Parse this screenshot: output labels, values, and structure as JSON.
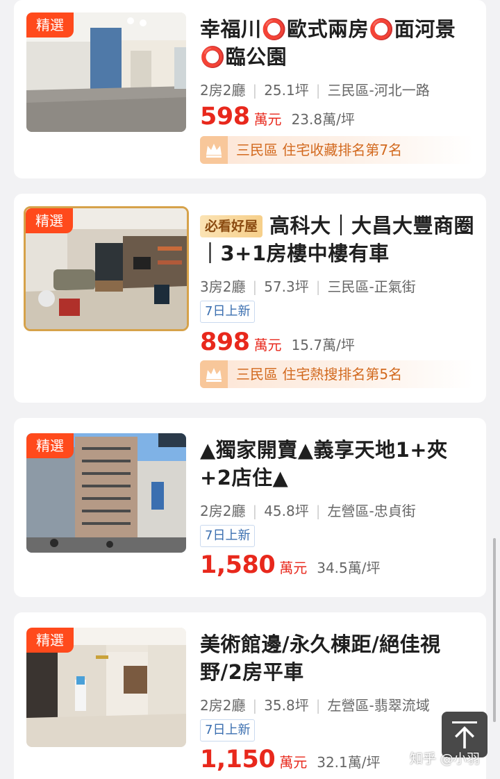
{
  "listings": [
    {
      "badge": "精選",
      "title": "幸福川⭕️歐式兩房⭕️面河景⭕️臨公園",
      "layout": "2房2廳",
      "size": "25.1坪",
      "location": "三民區-河北一路",
      "price": "598",
      "price_unit": "萬元",
      "price_per_ping": "23.8萬/坪",
      "rank_text": "三民區 住宅收藏排名第7名"
    },
    {
      "badge": "精選",
      "must_see": "必看好屋",
      "title": "高科大｜大昌大豐商圈｜3+1房樓中樓有車",
      "layout": "3房2廳",
      "size": "57.3坪",
      "location": "三民區-正氣街",
      "new_tag": "7日上新",
      "price": "898",
      "price_unit": "萬元",
      "price_per_ping": "15.7萬/坪",
      "rank_text": "三民區 住宅熱搜排名第5名"
    },
    {
      "badge": "精選",
      "title": "▲獨家開賣▲義享天地1+夾+2店住▲",
      "layout": "2房2廳",
      "size": "45.8坪",
      "location": "左營區-忠貞街",
      "new_tag": "7日上新",
      "price": "1,580",
      "price_unit": "萬元",
      "price_per_ping": "34.5萬/坪"
    },
    {
      "badge": "精選",
      "title": "美術館邊/永久棟距/絕佳視野/2房平車",
      "layout": "2房2廳",
      "size": "35.8坪",
      "location": "左營區-翡翠流域",
      "new_tag": "7日上新",
      "price": "1,150",
      "price_unit": "萬元",
      "price_per_ping": "32.1萬/坪"
    }
  ],
  "watermark": "知乎 @小羽",
  "icons": {
    "crown": "crown-icon",
    "back_to_top": "arrow-up-icon"
  },
  "colors": {
    "price": "#e8281c",
    "badge": "#ff4a1c",
    "rank_text": "#d2691e",
    "new_tag": "#3b6fb0"
  }
}
